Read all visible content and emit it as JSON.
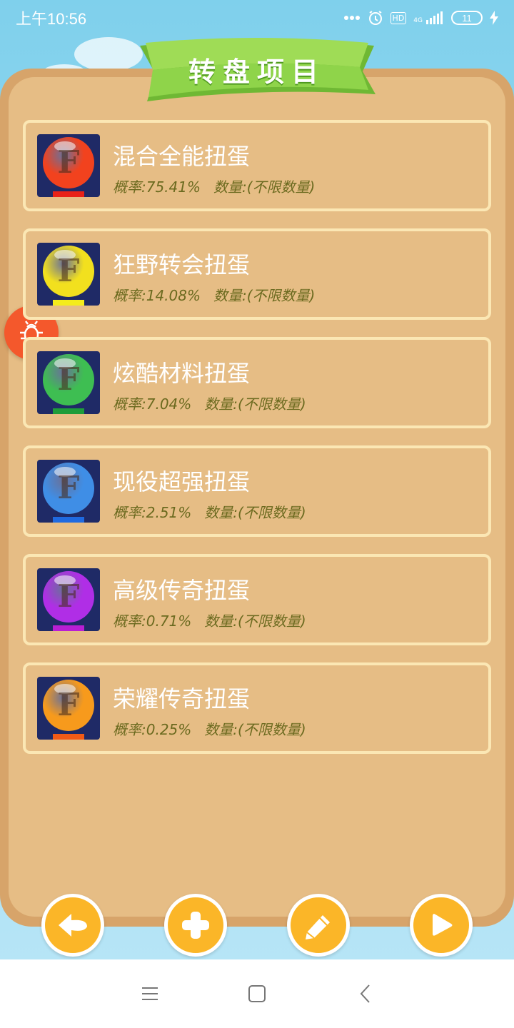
{
  "status_bar": {
    "time": "上午10:56",
    "network": "4G",
    "hd": "HD",
    "battery": "11"
  },
  "header": {
    "title": "转盘项目"
  },
  "items": [
    {
      "name": "混合全能扭蛋",
      "probability_label": "概率:75.41%",
      "quantity_label": "数量:(不限数量)",
      "color": "#f2421e",
      "base_color": "#e82218"
    },
    {
      "name": "狂野转会扭蛋",
      "probability_label": "概率:14.08%",
      "quantity_label": "数量:(不限数量)",
      "color": "#f2e01e",
      "base_color": "#f4ec1c"
    },
    {
      "name": "炫酷材料扭蛋",
      "probability_label": "概率:7.04%",
      "quantity_label": "数量:(不限数量)",
      "color": "#3ebe52",
      "base_color": "#1e9c3a"
    },
    {
      "name": "现役超强扭蛋",
      "probability_label": "概率:2.51%",
      "quantity_label": "数量:(不限数量)",
      "color": "#3f8ee6",
      "base_color": "#1f6ae0"
    },
    {
      "name": "高级传奇扭蛋",
      "probability_label": "概率:0.71%",
      "quantity_label": "数量:(不限数量)",
      "color": "#b02ee6",
      "base_color": "#b91ed4"
    },
    {
      "name": "荣耀传奇扭蛋",
      "probability_label": "概率:0.25%",
      "quantity_label": "数量:(不限数量)",
      "color": "#f79a1c",
      "base_color": "#f25a16"
    }
  ],
  "actions": {
    "back": "back-arrow-icon",
    "add": "plus-icon",
    "edit": "pencil-icon",
    "play": "play-icon"
  },
  "colors": {
    "sky": "#7fd0ec",
    "board_outer": "#d7a46a",
    "board_inner": "#e6bd85",
    "card_border": "#fbe7b4",
    "ribbon": "#8fd44a",
    "action_button": "#fbb628",
    "bug_button": "#f4582c"
  }
}
